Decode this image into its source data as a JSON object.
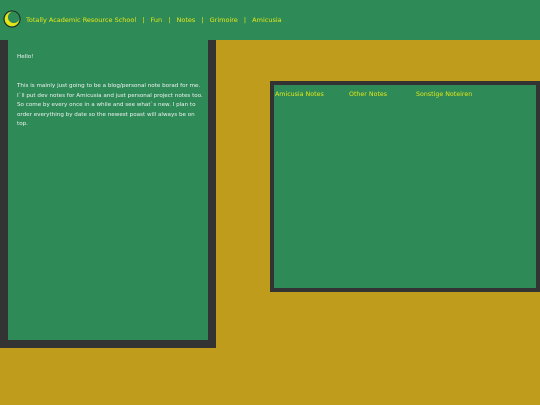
{
  "header": {
    "site_title": "Totally Academic Resource School",
    "nav": [
      {
        "label": "Fun"
      },
      {
        "label": "Notes"
      },
      {
        "label": "Grimoire"
      },
      {
        "label": "Amicusia"
      }
    ],
    "separator": "|"
  },
  "left_panel": {
    "greeting": "Hello!",
    "intro": "This is mainly just going to be a blog/personal note borad for me. I`ll put dev notes for Amicusia and just personal project notes too. So come by every once in a while and see what`s new. I plan to order everything by date so the newest poast will always be on top."
  },
  "right_panel": {
    "tabs": [
      {
        "label": "Amicusia Notes"
      },
      {
        "label": "Other Notes"
      },
      {
        "label": "Sonstige Noteiren"
      }
    ]
  },
  "colors": {
    "background": "#c09c1c",
    "panel_green": "#2e8b57",
    "panel_border": "#333333",
    "accent_yellow": "#e6e617"
  }
}
